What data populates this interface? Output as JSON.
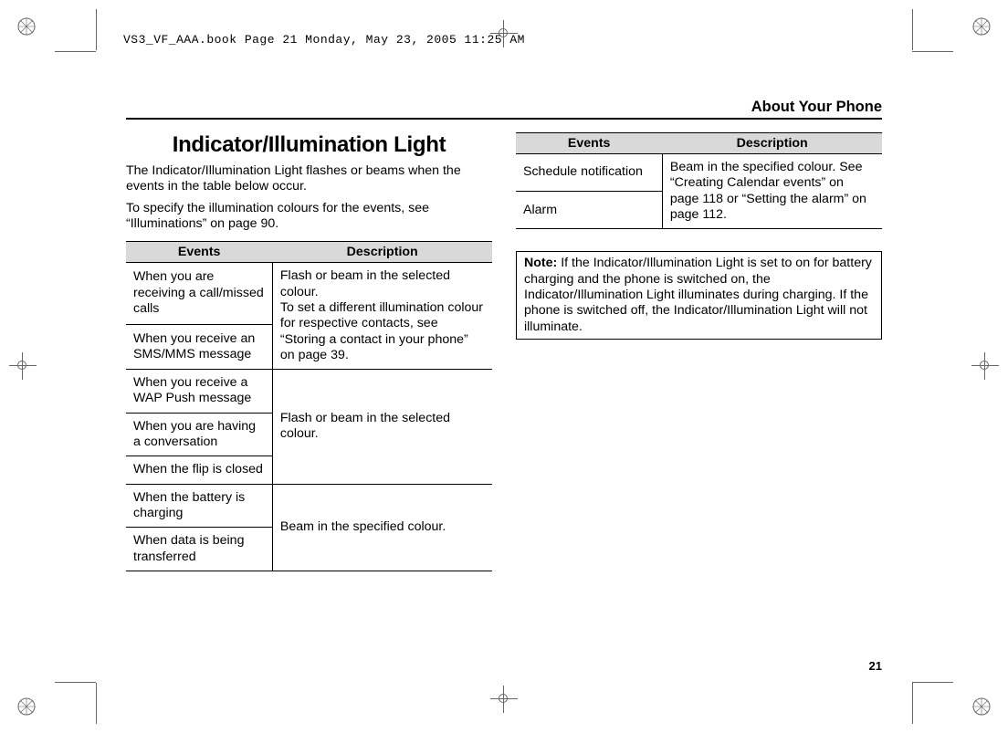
{
  "header_line": "VS3_VF_AAA.book  Page 21  Monday, May 23, 2005  11:25 AM",
  "section_title": "About Your Phone",
  "page_number": "21",
  "heading": "Indicator/Illumination Light",
  "intro": {
    "p1": "The Indicator/Illumination Light flashes or beams when the events in the table below occur.",
    "p2": "To specify the illumination colours for the events, see “Illuminations” on page 90."
  },
  "table_headers": {
    "events": "Events",
    "description": "Description"
  },
  "left_table": {
    "r1_event": "When you are receiving a call/missed calls",
    "r2_event": "When you receive an SMS/MMS message",
    "desc_a": "Flash or beam in the selected colour.\nTo set a different illumination colour for respective contacts, see “Storing a contact in your phone” on page 39.",
    "r3_event": "When you receive a WAP Push message",
    "r4_event": "When you are having a conversation",
    "r5_event": "When the flip is closed",
    "desc_b": "Flash or beam in the selected colour.",
    "r6_event": "When the battery is charging",
    "r7_event": "When data is being transferred",
    "desc_c": "Beam in the specified colour."
  },
  "right_table": {
    "r1_event": "Schedule notification",
    "r2_event": "Alarm",
    "desc": "Beam in the specified colour. See “Creating Calendar events” on page 118 or “Setting the alarm” on page 112."
  },
  "note": {
    "label": "Note:",
    "body": "If the Indicator/Illumination Light is set to on for battery charging and the phone is switched on, the Indicator/Illumination Light illuminates during charging. If the phone is switched off, the Indicator/Illumination Light will not illuminate."
  }
}
